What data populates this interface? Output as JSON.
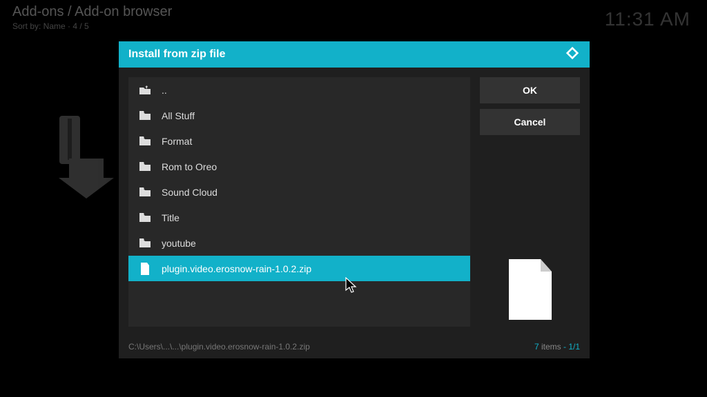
{
  "background": {
    "title": "Add-ons / Add-on browser",
    "sort": "Sort by: Name  ·  4 / 5",
    "clock": "11:31 AM"
  },
  "dialog": {
    "title": "Install from zip file",
    "buttons": {
      "ok": "OK",
      "cancel": "Cancel"
    },
    "items": [
      {
        "label": "..",
        "type": "up"
      },
      {
        "label": "All Stuff",
        "type": "folder"
      },
      {
        "label": "Format",
        "type": "folder"
      },
      {
        "label": "Rom to Oreo",
        "type": "folder"
      },
      {
        "label": "Sound Cloud",
        "type": "folder"
      },
      {
        "label": "Title",
        "type": "folder"
      },
      {
        "label": "youtube",
        "type": "folder"
      },
      {
        "label": "plugin.video.erosnow-rain-1.0.2.zip",
        "type": "file",
        "selected": true
      }
    ],
    "footer": {
      "path": "C:\\Users\\...\\...\\plugin.video.erosnow-rain-1.0.2.zip",
      "countLabel": "items",
      "count": "7",
      "page": "1/1"
    }
  }
}
